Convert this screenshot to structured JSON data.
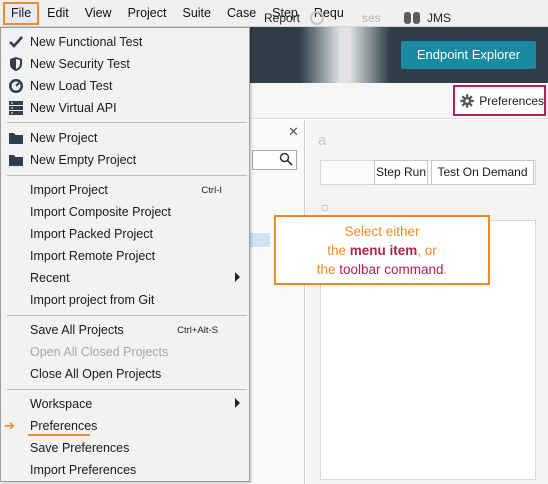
{
  "menubar": {
    "items": [
      "File",
      "Edit",
      "View",
      "Project",
      "Suite",
      "Case",
      "Step",
      "Requ"
    ]
  },
  "header": {
    "endpoint_explorer_label": "Endpoint Explorer"
  },
  "toolbar": {
    "report_label": "Report",
    "faded_label": "ses",
    "jms_label": "JMS",
    "preferences_label": "Preferences"
  },
  "right_panel": {
    "fragment": "a",
    "step_run_label": "Step Run",
    "test_on_demand_label": "Test On Demand"
  },
  "callout": {
    "line1": "Select either",
    "line2_pre": "the ",
    "line2_bold": "menu item",
    "line2_post": ", or",
    "line3_pre": "the ",
    "line3_hl": "toolbar command",
    "line3_post": "."
  },
  "file_menu": {
    "new_functional_test": "New Functional Test",
    "new_security_test": "New Security Test",
    "new_load_test": "New Load Test",
    "new_virtual_api": "New Virtual API",
    "new_project": "New Project",
    "new_empty_project": "New Empty Project",
    "import_project": "Import Project",
    "import_project_shortcut": "Ctrl-I",
    "import_composite_project": "Import Composite Project",
    "import_packed_project": "Import Packed Project",
    "import_remote_project": "Import Remote Project",
    "recent": "Recent",
    "import_from_git": "Import project from Git",
    "save_all_projects": "Save All Projects",
    "save_all_shortcut": "Ctrl+Alt-S",
    "open_all_closed": "Open All Closed Projects",
    "close_all_open": "Close All Open Projects",
    "workspace": "Workspace",
    "preferences": "Preferences",
    "save_preferences": "Save Preferences",
    "import_preferences": "Import Preferences"
  },
  "colors": {
    "highlight_orange": "#f08a24",
    "highlight_crimson": "#b0234b",
    "endpoint_button": "#1a8aa0",
    "header_dark": "#2f3e48"
  }
}
